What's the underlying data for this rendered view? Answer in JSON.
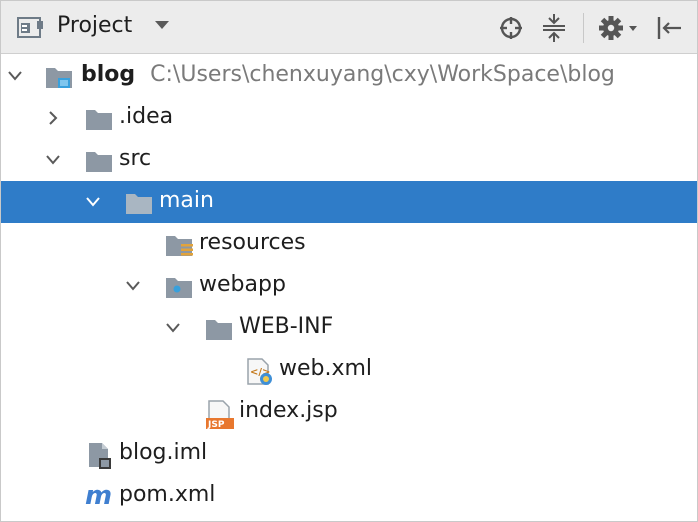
{
  "toolbar": {
    "title": "Project",
    "icons": [
      "project-view-icon",
      "dropdown-caret-icon",
      "locate-icon",
      "collapse-all-icon",
      "settings-gear-icon",
      "hide-panel-icon"
    ]
  },
  "tree": [
    {
      "label": "blog",
      "path": "C:\\Users\\chenxuyang\\cxy\\WorkSpace\\blog",
      "expanded": true,
      "icon": "module-folder-icon"
    },
    {
      "label": ".idea",
      "expanded": false,
      "icon": "folder-icon"
    },
    {
      "label": "src",
      "expanded": true,
      "icon": "folder-icon"
    },
    {
      "label": "main",
      "expanded": true,
      "icon": "folder-icon",
      "selected": true
    },
    {
      "label": "resources",
      "icon": "resources-folder-icon"
    },
    {
      "label": "webapp",
      "expanded": true,
      "icon": "web-folder-icon"
    },
    {
      "label": "WEB-INF",
      "expanded": true,
      "icon": "folder-icon"
    },
    {
      "label": "web.xml",
      "icon": "xml-file-icon"
    },
    {
      "label": "index.jsp",
      "icon": "jsp-file-icon"
    },
    {
      "label": "blog.iml",
      "icon": "iml-file-icon"
    },
    {
      "label": "pom.xml",
      "icon": "maven-file-icon"
    }
  ],
  "colors": {
    "selection": "#2f7cc8",
    "folder": "#8d98a4",
    "toolbar_bg": "#ececec"
  }
}
